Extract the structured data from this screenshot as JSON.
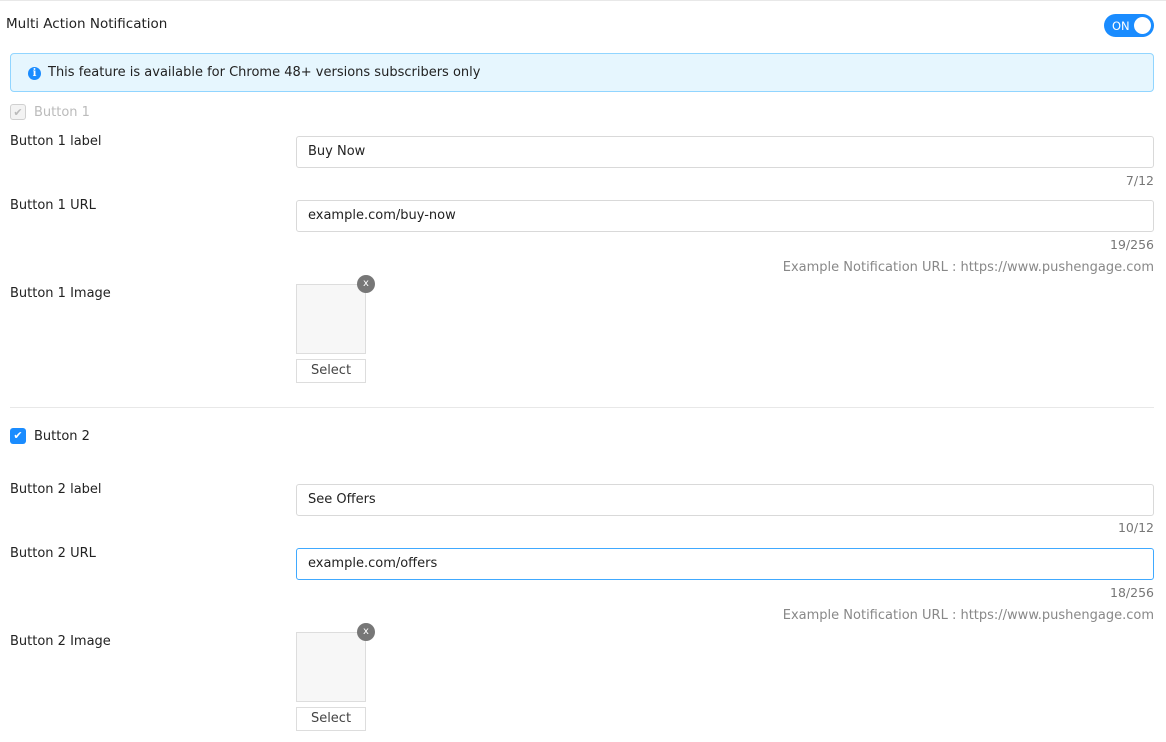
{
  "title": "Multi Action Notification",
  "toggle": {
    "label": "ON",
    "on": true
  },
  "alert": {
    "icon": "info-icon",
    "text": "This feature is available for Chrome 48+ versions subscribers only"
  },
  "buttons": [
    {
      "checkbox": "Button 1",
      "checked": true,
      "disabled": true,
      "label_title": "Button 1 label",
      "label_value": "Buy Now",
      "label_count": "7/12",
      "url_title": "Button 1 URL",
      "url_value": "example.com/buy-now",
      "url_count": "19/256",
      "hint": "Example Notification URL : https://www.pushengage.com",
      "image_title": "Button 1 Image",
      "remove": "x",
      "select": "Select"
    },
    {
      "checkbox": "Button 2",
      "checked": true,
      "disabled": false,
      "label_title": "Button 2 label",
      "label_value": "See Offers",
      "label_count": "10/12",
      "url_title": "Button 2 URL",
      "url_value": "example.com/offers",
      "url_count": "18/256",
      "hint": "Example Notification URL : https://www.pushengage.com",
      "image_title": "Button 2 Image",
      "remove": "x",
      "select": "Select"
    }
  ]
}
